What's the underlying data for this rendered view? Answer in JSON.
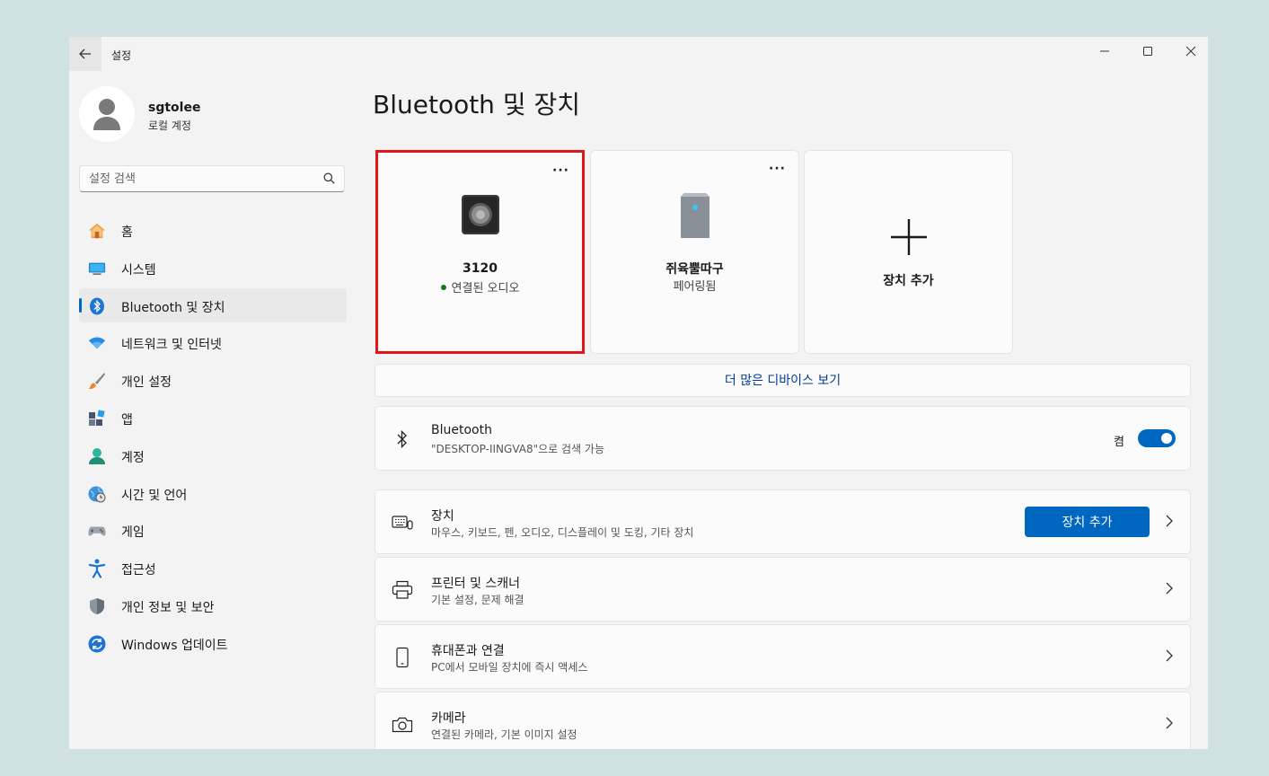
{
  "window": {
    "title": "설정"
  },
  "profile": {
    "name": "sgtolee",
    "account_type": "로컬 계정"
  },
  "search": {
    "placeholder": "설정 검색"
  },
  "nav": {
    "items": [
      {
        "label": "홈",
        "icon": "home-icon"
      },
      {
        "label": "시스템",
        "icon": "system-icon"
      },
      {
        "label": "Bluetooth 및 장치",
        "icon": "bluetooth-icon",
        "active": true
      },
      {
        "label": "네트워크 및 인터넷",
        "icon": "wifi-icon"
      },
      {
        "label": "개인 설정",
        "icon": "brush-icon"
      },
      {
        "label": "앱",
        "icon": "apps-icon"
      },
      {
        "label": "계정",
        "icon": "account-icon"
      },
      {
        "label": "시간 및 언어",
        "icon": "globe-clock-icon"
      },
      {
        "label": "게임",
        "icon": "gamepad-icon"
      },
      {
        "label": "접근성",
        "icon": "accessibility-icon"
      },
      {
        "label": "개인 정보 및 보안",
        "icon": "shield-icon"
      },
      {
        "label": "Windows 업데이트",
        "icon": "update-icon"
      }
    ]
  },
  "main": {
    "title": "Bluetooth 및 장치",
    "tiles": [
      {
        "name": "3120",
        "status": "연결된 오디오",
        "connected": true,
        "more": "···"
      },
      {
        "name": "쥐육뿔따구",
        "status": "페어링됨",
        "more": "···"
      }
    ],
    "add_tile_label": "장치 추가",
    "more_devices_label": "더 많은 디바이스 보기",
    "bluetooth": {
      "title": "Bluetooth",
      "subtitle": "\"DESKTOP-IINGVA8\"으로 검색 가능",
      "toggle_label": "켬"
    },
    "cards": {
      "devices": {
        "title": "장치",
        "subtitle": "마우스, 키보드, 펜, 오디오, 디스플레이 및 도킹, 기타 장치",
        "button": "장치 추가"
      },
      "printers": {
        "title": "프린터 및 스캐너",
        "subtitle": "기본 설정, 문제 해결"
      },
      "phone": {
        "title": "휴대폰과 연결",
        "subtitle": "PC에서 모바일 장치에 즉시 액세스"
      },
      "camera": {
        "title": "카메라",
        "subtitle": "연결된 카메라, 기본 이미지 설정"
      }
    }
  },
  "colors": {
    "accent": "#0067c0",
    "selection_outline": "#e0161b",
    "connected_dot": "#107c10"
  }
}
